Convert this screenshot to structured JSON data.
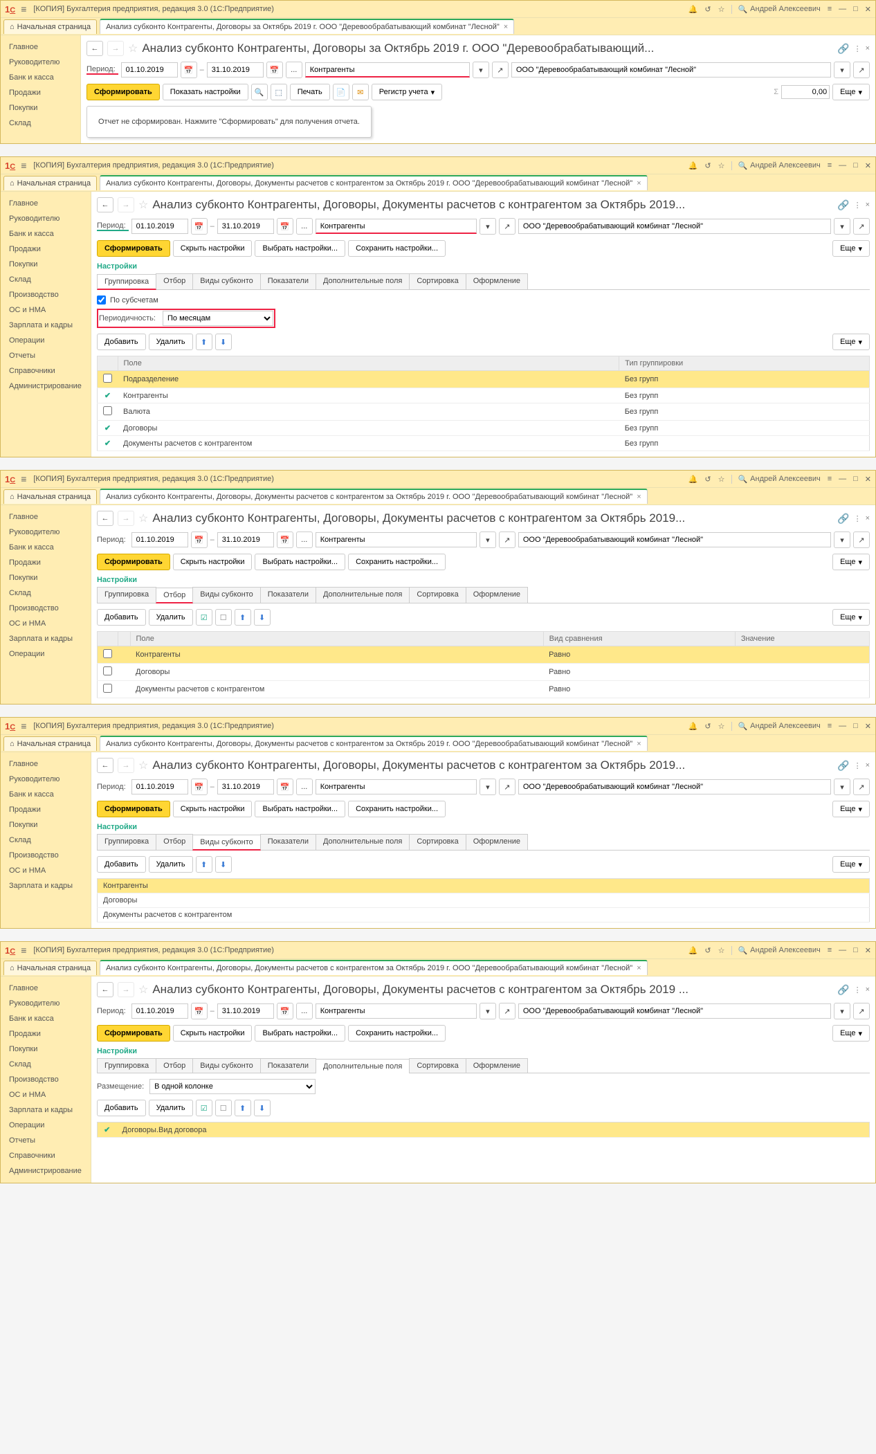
{
  "common": {
    "title_prefix": "[КОПИЯ] Бухгалтерия предприятия, редакция 3.0  (1С:Предприятие)",
    "user": "Андрей Алексеевич",
    "home": "Начальная страница",
    "date_from": "01.10.2019",
    "date_to": "31.10.2019",
    "subkonto": "Контрагенты",
    "org": "ООО \"Деревообрабатывающий комбинат \"Лесной\"",
    "period_lbl": "Период:",
    "form_btn": "Сформировать",
    "more_btn": "Еще",
    "add_btn": "Добавить",
    "del_btn": "Удалить",
    "hide_btn": "Скрыть настройки",
    "choose_btn": "Выбрать настройки...",
    "save_btn": "Сохранить настройки...",
    "settings_lbl": "Настройки",
    "settings_tabs": [
      "Группировка",
      "Отбор",
      "Виды субконто",
      "Показатели",
      "Дополнительные поля",
      "Сортировка",
      "Оформление"
    ]
  },
  "side1": [
    "Главное",
    "Руководителю",
    "Банк и касса",
    "Продажи",
    "Покупки",
    "Склад"
  ],
  "side2": [
    "Главное",
    "Руководителю",
    "Банк и касса",
    "Продажи",
    "Покупки",
    "Склад",
    "Производство",
    "ОС и НМА",
    "Зарплата и кадры",
    "Операции",
    "Отчеты",
    "Справочники",
    "Администрирование"
  ],
  "side3": [
    "Главное",
    "Руководителю",
    "Банк и касса",
    "Продажи",
    "Покупки",
    "Склад",
    "Производство",
    "ОС и НМА",
    "Зарплата и кадры",
    "Операции"
  ],
  "side4": [
    "Главное",
    "Руководителю",
    "Банк и касса",
    "Продажи",
    "Покупки",
    "Склад",
    "Производство",
    "ОС и НМА",
    "Зарплата и кадры"
  ],
  "w1": {
    "tab": "Анализ субконто Контрагенты, Договоры за Октябрь 2019 г. ООО \"Деревообрабатывающий комбинат \"Лесной\"",
    "h1": "Анализ субконто Контрагенты, Договоры за Октябрь 2019 г. ООО \"Деревообрабатывающий...",
    "show_btn": "Показать настройки",
    "print_btn": "Печать",
    "reg_btn": "Регистр учета",
    "sum_val": "0,00",
    "msg": "Отчет не сформирован. Нажмите \"Сформировать\" для получения отчета."
  },
  "w2": {
    "tab": "Анализ субконто Контрагенты, Договоры, Документы расчетов с контрагентом за Октябрь 2019 г. ООО \"Деревообрабатывающий комбинат \"Лесной\"",
    "h1": "Анализ субконто Контрагенты, Договоры, Документы расчетов с контрагентом за Октябрь 2019...",
    "by_sub": "По субсчетам",
    "period_lbl2": "Периодичность:",
    "period_val": "По месяцам",
    "th1": "Поле",
    "th2": "Тип группировки",
    "rows": [
      {
        "chk": false,
        "field": "Подразделение",
        "grp": "Без групп",
        "sel": true
      },
      {
        "chk": true,
        "field": "Контрагенты",
        "grp": "Без групп"
      },
      {
        "chk": false,
        "field": "Валюта",
        "grp": "Без групп"
      },
      {
        "chk": true,
        "field": "Договоры",
        "grp": "Без групп"
      },
      {
        "chk": true,
        "field": "Документы расчетов с контрагентом",
        "grp": "Без групп"
      }
    ]
  },
  "w3": {
    "th1": "Поле",
    "th2": "Вид сравнения",
    "th3": "Значение",
    "rows": [
      {
        "field": "Контрагенты",
        "cmp": "Равно",
        "sel": true
      },
      {
        "field": "Договоры",
        "cmp": "Равно"
      },
      {
        "field": "Документы расчетов с контрагентом",
        "cmp": "Равно"
      }
    ]
  },
  "w4": {
    "rows": [
      "Контрагенты",
      "Договоры",
      "Документы расчетов с контрагентом"
    ]
  },
  "w5": {
    "h1": "Анализ субконто Контрагенты, Договоры, Документы расчетов с контрагентом за Октябрь 2019 ...",
    "place_lbl": "Размещение:",
    "place_val": "В одной колонке",
    "row": "Договоры.Вид договора"
  }
}
